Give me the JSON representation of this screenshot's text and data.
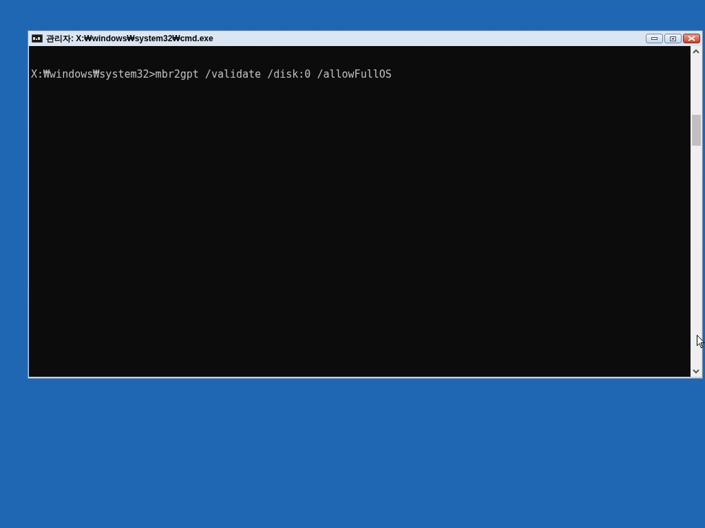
{
  "window": {
    "title": "관리자: X:₩windows₩system32₩cmd.exe"
  },
  "console": {
    "lines": [
      "X:₩windows₩system32>mbr2gpt /validate /disk:0 /allowFullOS"
    ]
  }
}
